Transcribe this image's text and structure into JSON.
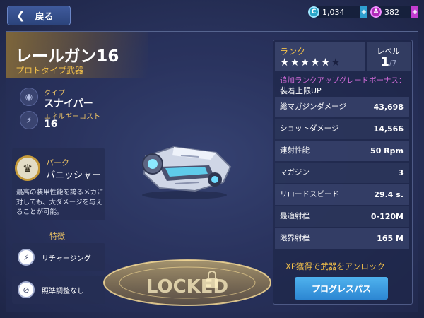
{
  "topbar": {
    "back_label": "戻る",
    "currency_cyan": {
      "icon": "c-coin-icon",
      "letter": "C",
      "amount": "1,034",
      "plus": "+"
    },
    "currency_purple": {
      "icon": "a-coin-icon",
      "letter": "A",
      "amount": "382",
      "plus": "+"
    }
  },
  "weapon": {
    "name": "レールガン16",
    "class": "プロトタイプ武器",
    "type_label": "タイプ",
    "type_value": "スナイパー",
    "energy_label": "エネルギーコスト",
    "energy_value": "16",
    "locked_text": "LOCKED"
  },
  "perk": {
    "label": "パーク",
    "name": "パニッシャー",
    "description": "最高の装甲性能を誇るメカに対しても、大ダメージを与えることが可能。"
  },
  "features": {
    "title": "特徴",
    "items": [
      {
        "label": "リチャージング",
        "icon": "recharge-icon"
      },
      {
        "label": "照準調整なし",
        "icon": "no-aim-icon"
      }
    ]
  },
  "rank": {
    "label": "ランク",
    "stars_filled": 5,
    "stars_total": 6,
    "level_label": "レベル",
    "level_current": "1",
    "level_max": "/7",
    "bonus_title": "追加ランクアップグレードボーナス：",
    "bonus_value": "装着上限UP"
  },
  "stats": [
    {
      "name": "総マガジンダメージ",
      "value": "43,698"
    },
    {
      "name": "ショットダメージ",
      "value": "14,566"
    },
    {
      "name": "連射性能",
      "value": "50 Rpm"
    },
    {
      "name": "マガジン",
      "value": "3"
    },
    {
      "name": "リロードスピード",
      "value": "29.4 s."
    },
    {
      "name": "最適射程",
      "value": "0-120M"
    },
    {
      "name": "限界射程",
      "value": "165 M"
    }
  ],
  "unlock": {
    "text": "XP獲得で武器をアンロック",
    "button_label": "プログレスパス"
  },
  "colors": {
    "accent_gold": "#f2c04a",
    "bonus_purple": "#d26bd9",
    "button_blue": "#3a9be0",
    "background": "#2b3560"
  }
}
